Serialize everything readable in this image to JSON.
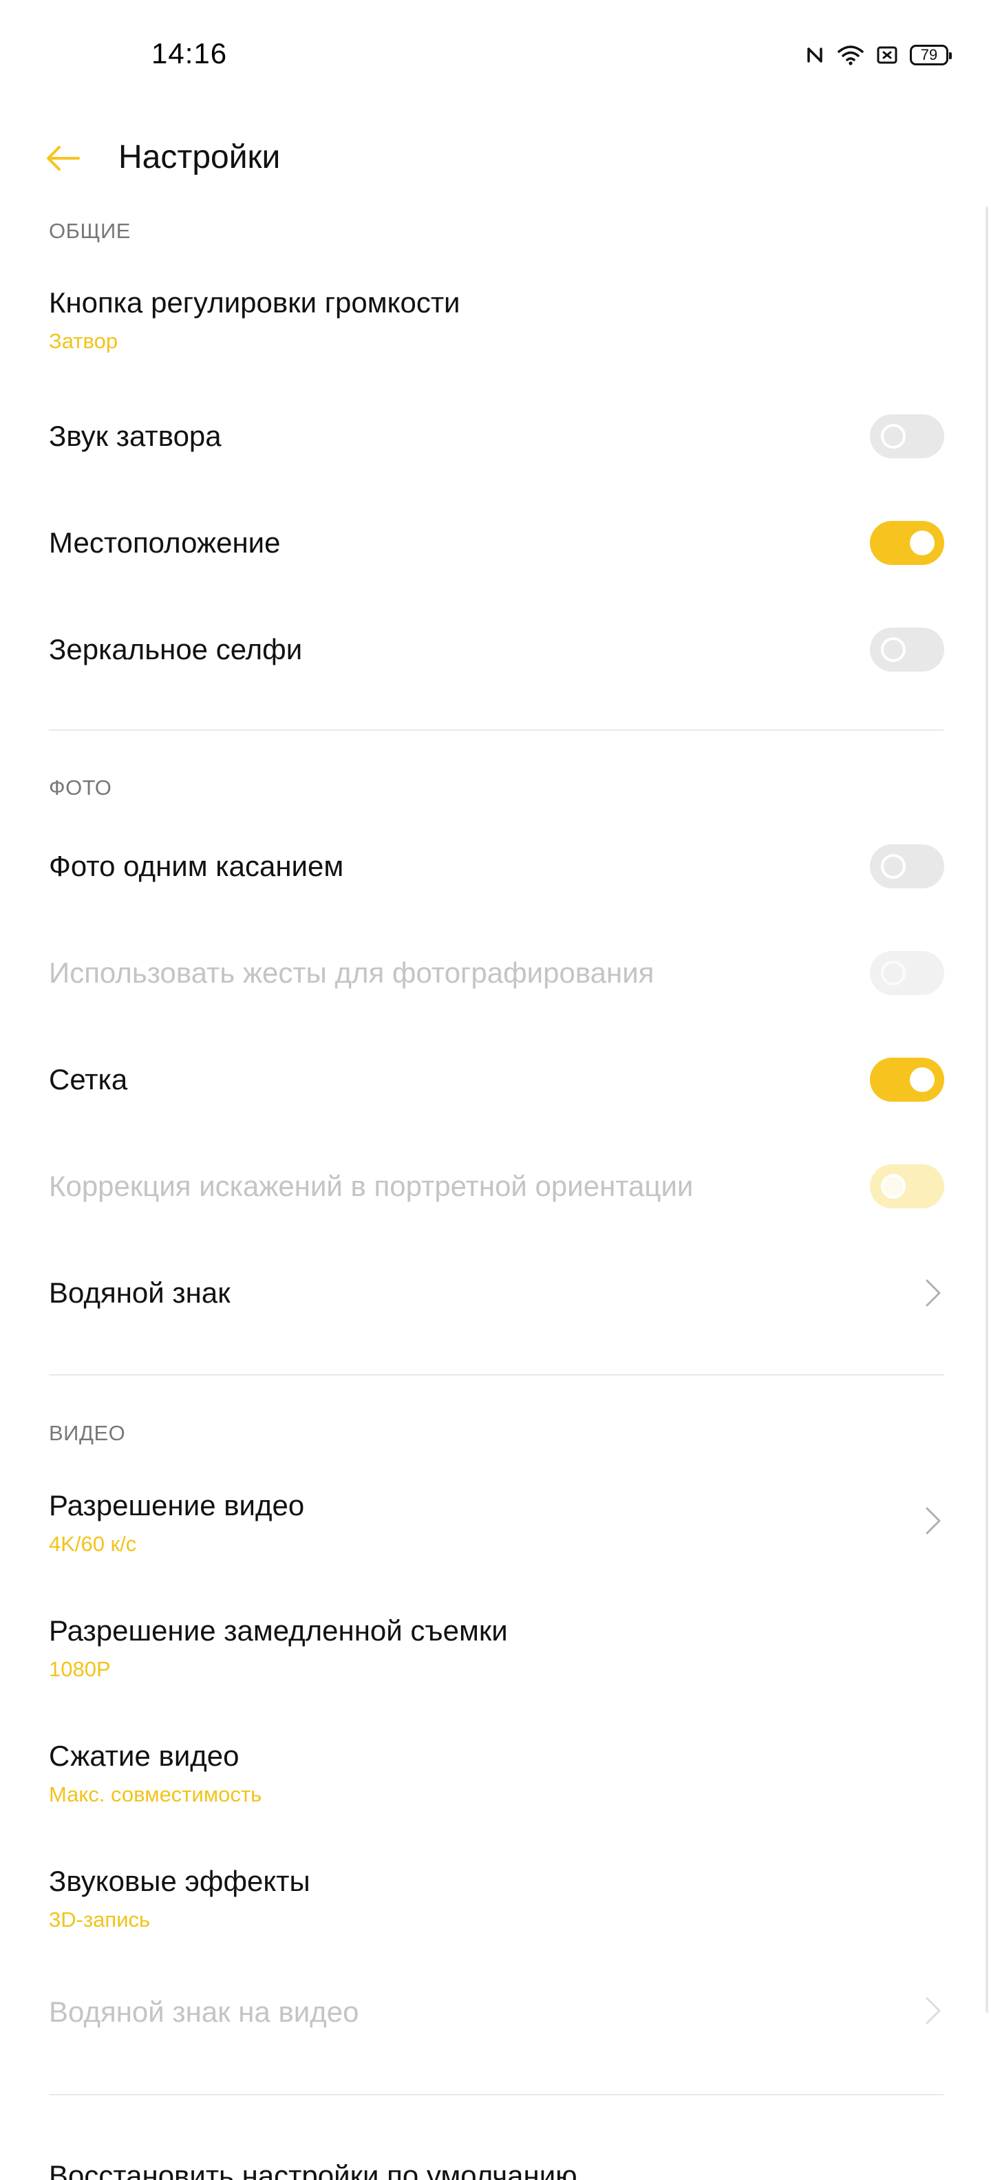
{
  "status_bar": {
    "time": "14:16",
    "battery": "79",
    "icons": [
      "nfc-icon",
      "wifi-icon",
      "sim-icon",
      "battery-icon"
    ]
  },
  "header": {
    "back_icon": "arrow-left-icon",
    "title": "Настройки"
  },
  "colors": {
    "accent": "#f7c31e",
    "subtitle": "#f2c31a",
    "section_header": "#777777",
    "disabled_text": "#c4c4c4"
  },
  "sections": {
    "general": {
      "label": "ОБЩИЕ",
      "volume_button": {
        "title": "Кнопка регулировки громкости",
        "value": "Затвор"
      },
      "shutter_sound": {
        "title": "Звук затвора",
        "toggle": false
      },
      "location": {
        "title": "Местоположение",
        "toggle": true
      },
      "mirror_selfie": {
        "title": "Зеркальное селфи",
        "toggle": false
      }
    },
    "photo": {
      "label": "ФОТО",
      "one_touch": {
        "title": "Фото одним касанием",
        "toggle": false
      },
      "gestures": {
        "title": "Использовать жесты для фотографирования",
        "toggle": false,
        "enabled": false
      },
      "grid": {
        "title": "Сетка",
        "toggle": true
      },
      "distortion": {
        "title": "Коррекция искажений в портретной ориентации",
        "toggle": true,
        "enabled": false
      },
      "watermark": {
        "title": "Водяной знак"
      }
    },
    "video": {
      "label": "ВИДЕО",
      "resolution": {
        "title": "Разрешение видео",
        "value": "4K/60 к/с"
      },
      "slowmo": {
        "title": "Разрешение замедленной съемки",
        "value": "1080P"
      },
      "compression": {
        "title": "Сжатие видео",
        "value": "Макс. совместимость"
      },
      "sound_effects": {
        "title": "Звуковые эффекты",
        "value": "3D-запись"
      },
      "video_watermark": {
        "title": "Водяной знак на видео",
        "enabled": false
      }
    },
    "reset": {
      "title": "Восстановить настройки по умолчанию"
    }
  }
}
